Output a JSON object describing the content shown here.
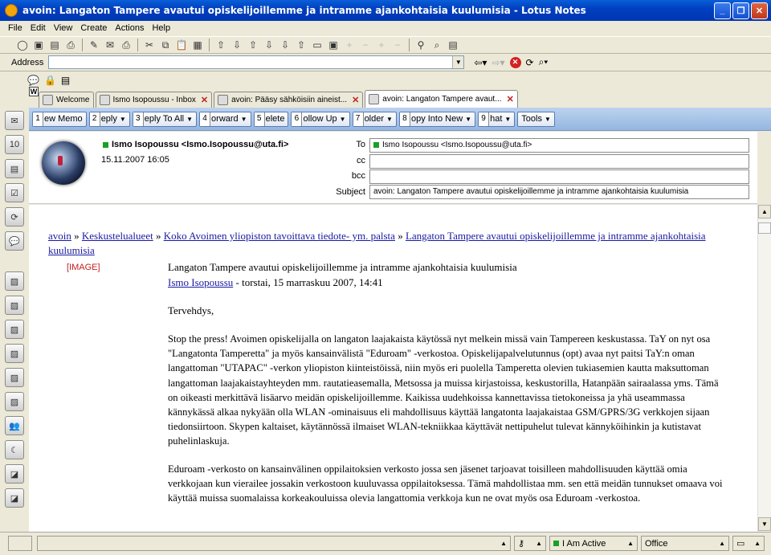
{
  "window": {
    "title": "avoin: Langaton Tampere avautui opiskelijoillemme ja intramme ajankohtaisia kuulumisia - Lotus Notes"
  },
  "menu": [
    "File",
    "Edit",
    "View",
    "Create",
    "Actions",
    "Help"
  ],
  "address": {
    "label": "Address",
    "value": ""
  },
  "tabs": [
    {
      "label": "Welcome"
    },
    {
      "label": "Ismo Isopoussu - Inbox"
    },
    {
      "label": "avoin: Pääsy sähköisiin aineist..."
    },
    {
      "label": "avoin: Langaton Tampere avaut..."
    }
  ],
  "tab_badge": "W",
  "actions": [
    {
      "num": "1",
      "label": "ew Memo",
      "dropdown": false
    },
    {
      "num": "2",
      "label": "eply",
      "dropdown": true
    },
    {
      "num": "3",
      "label": "eply To All",
      "dropdown": true
    },
    {
      "num": "4",
      "label": "orward",
      "dropdown": true
    },
    {
      "num": "5",
      "label": "elete",
      "dropdown": false
    },
    {
      "num": "6",
      "label": "ollow Up",
      "dropdown": true
    },
    {
      "num": "7",
      "label": "older",
      "dropdown": true
    },
    {
      "num": "8",
      "label": "opy Into New",
      "dropdown": true
    },
    {
      "num": "9",
      "label": "hat",
      "dropdown": true
    },
    {
      "num": "",
      "label": "Tools",
      "dropdown": true
    }
  ],
  "header": {
    "sender": "Ismo Isopoussu <Ismo.Isopoussu@uta.fi>",
    "date": "15.11.2007 16:05",
    "to_label": "To",
    "to": "Ismo Isopoussu <Ismo.Isopoussu@uta.fi>",
    "cc_label": "cc",
    "cc": "",
    "bcc_label": "bcc",
    "bcc": "",
    "subject_label": "Subject",
    "subject": "avoin: Langaton Tampere avautui opiskelijoillemme ja intramme ajankohtaisia kuulumisia"
  },
  "body": {
    "crumbs": {
      "c1": "avoin",
      "c2": "Keskustelualueet",
      "c3": "Koko Avoimen yliopiston tavoittava tiedote- ym. palsta",
      "c4": "Langaton Tampere avautui opiskelijoillemme ja intramme ajankohtaisia kuulumisia",
      "sep": "»"
    },
    "image_placeholder": "[IMAGE]",
    "subject": "Langaton Tampere avautui opiskelijoillemme ja intramme ajankohtaisia kuulumisia",
    "author": "Ismo Isopoussu",
    "byline_rest": " - torstai,  15 marraskuu 2007, 14:41",
    "greeting": "Tervehdys,",
    "p1": "Stop the press! Avoimen opiskelijalla on langaton laajakaista käytössä nyt melkein missä vain Tampereen keskustassa. TaY on nyt osa \"Langatonta Tamperetta\" ja myös kansainvälistä \"Eduroam\" -verkostoa. Opiskelijapalvelutunnus (opt) avaa nyt paitsi TaY:n oman langattoman \"UTAPAC\" -verkon yliopiston kiinteistöissä, niin myös eri puolella Tamperetta olevien tukiasemien kautta maksuttoman langattoman laajakaistayhteyden mm. rautatieasemalla, Metsossa ja muissa kirjastoissa, keskustorilla, Hatanpään sairaalassa yms. Tämä on oikeasti merkittävä lisäarvo meidän opiskelijoillemme. Kaikissa uudehkoissa kannettavissa tietokoneissa ja yhä useammassa kännykässä alkaa nykyään olla WLAN -ominaisuus eli mahdollisuus käyttää langatonta laajakaistaa GSM/GPRS/3G verkkojen sijaan tiedonsiirtoon. Skypen kaltaiset, käytännössä ilmaiset WLAN-tekniikkaa käyttävät nettipuhelut tulevat kännyköihinkin ja kutistavat puhelinlaskuja.",
    "p2": "Eduroam -verkosto on kansainvälinen oppilaitoksien verkosto jossa sen jäsenet tarjoavat toisilleen mahdollisuuden käyttää omia verkkojaan kun vierailee jossakin verkostoon kuuluvassa oppilaitoksessa. Tämä mahdollistaa mm. sen että meidän tunnukset omaava voi käyttää muissa suomalaissa korkeakouluissa olevia langattomia verkkoja kun ne ovat myös osa Eduroam -verkostoa."
  },
  "status": {
    "presence": "I Am Active",
    "location": "Office"
  }
}
